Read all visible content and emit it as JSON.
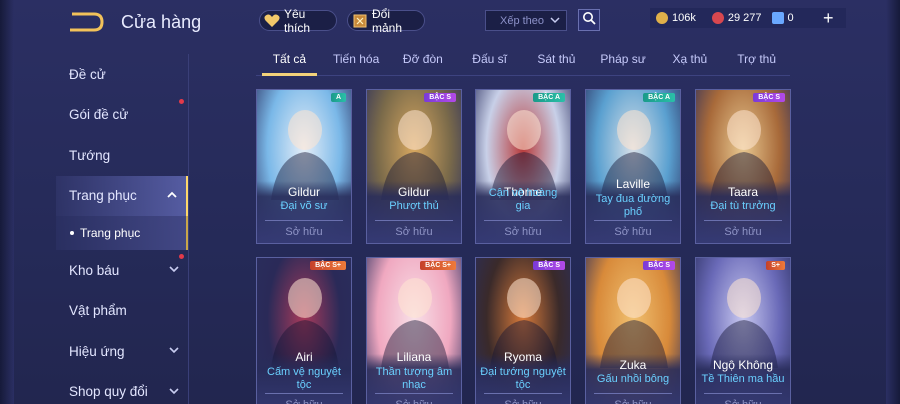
{
  "header": {
    "title": "Cửa hàng",
    "favorite_label": "Yêu thích",
    "exchange_label": "Đổi mảnh",
    "sort_label": "Xếp theo",
    "currencies": [
      {
        "value": "106k",
        "color": "#e0b04a"
      },
      {
        "value": "29 277",
        "color": "#d8474f"
      },
      {
        "value": "0",
        "color": "#6aa8ff"
      }
    ],
    "plus": "+"
  },
  "sidebar": {
    "items": [
      {
        "label": "Đề cử",
        "dot": false,
        "chevron": null
      },
      {
        "label": "Gói đề cử",
        "dot": true,
        "chevron": null
      },
      {
        "label": "Tướng",
        "dot": false,
        "chevron": null
      },
      {
        "label": "Trang phục",
        "dot": false,
        "chevron": "up",
        "active": true
      },
      {
        "label": "Kho báu",
        "dot": true,
        "chevron": "down"
      },
      {
        "label": "Vật phẩm",
        "dot": false,
        "chevron": null
      },
      {
        "label": "Hiệu ứng",
        "dot": false,
        "chevron": "down"
      },
      {
        "label": "Shop quy đổi",
        "dot": false,
        "chevron": "down"
      }
    ],
    "sub_item": "Trang phục"
  },
  "tabs": [
    "Tất cả",
    "Tiến hóa",
    "Đỡ đòn",
    "Đấu sĩ",
    "Sát thủ",
    "Pháp sư",
    "Xạ thủ",
    "Trợ thủ"
  ],
  "active_tab": 0,
  "owned_label": "Sở hữu",
  "cards": [
    {
      "hero": "Gildur",
      "skin": "Đại võ sư",
      "badge": "A",
      "badge_type": "a",
      "c1": "#7ab8e8",
      "c2": "#e6eef8"
    },
    {
      "hero": "Gildur",
      "skin": "Phượt thủ",
      "badge": "BẬC S",
      "badge_type": "s",
      "c1": "#7a6a4a",
      "c2": "#d8a860"
    },
    {
      "hero": "Thorne",
      "skin": "Cận vệ hoàng gia",
      "badge": "BẬC A",
      "badge_type": "a",
      "c1": "#c8d0e8",
      "c2": "#b83a3a"
    },
    {
      "hero": "Laville",
      "skin": "Tay đua đường phố",
      "badge": "BẬC A",
      "badge_type": "a",
      "c1": "#5aa0d0",
      "c2": "#d8e0e8"
    },
    {
      "hero": "Taara",
      "skin": "Đại tù trưởng",
      "badge": "BẬC S",
      "badge_type": "s",
      "c1": "#a86a3a",
      "c2": "#e8c890"
    },
    {
      "hero": "Airi",
      "skin": "Cấm vệ nguyệt tộc",
      "badge": "BẬC S+",
      "badge_type": "sp",
      "c1": "#2a2a58",
      "c2": "#a83a5a"
    },
    {
      "hero": "Liliana",
      "skin": "Thần tượng âm nhạc",
      "badge": "BẬC S+",
      "badge_type": "sp",
      "c1": "#f0a8c0",
      "c2": "#f8e0e8"
    },
    {
      "hero": "Ryoma",
      "skin": "Đại tướng nguyệt tộc",
      "badge": "BẬC S",
      "badge_type": "s",
      "c1": "#3a2a2a",
      "c2": "#d87a3a"
    },
    {
      "hero": "Zuka",
      "skin": "Gấu nhồi bông",
      "badge": "BẬC S",
      "badge_type": "s",
      "c1": "#d88a3a",
      "c2": "#f0c070"
    },
    {
      "hero": "Ngộ Không",
      "skin": "Tề Thiên ma hầu",
      "badge": "S+",
      "badge_type": "sp",
      "c1": "#6a6ab8",
      "c2": "#c8c8f0"
    }
  ]
}
